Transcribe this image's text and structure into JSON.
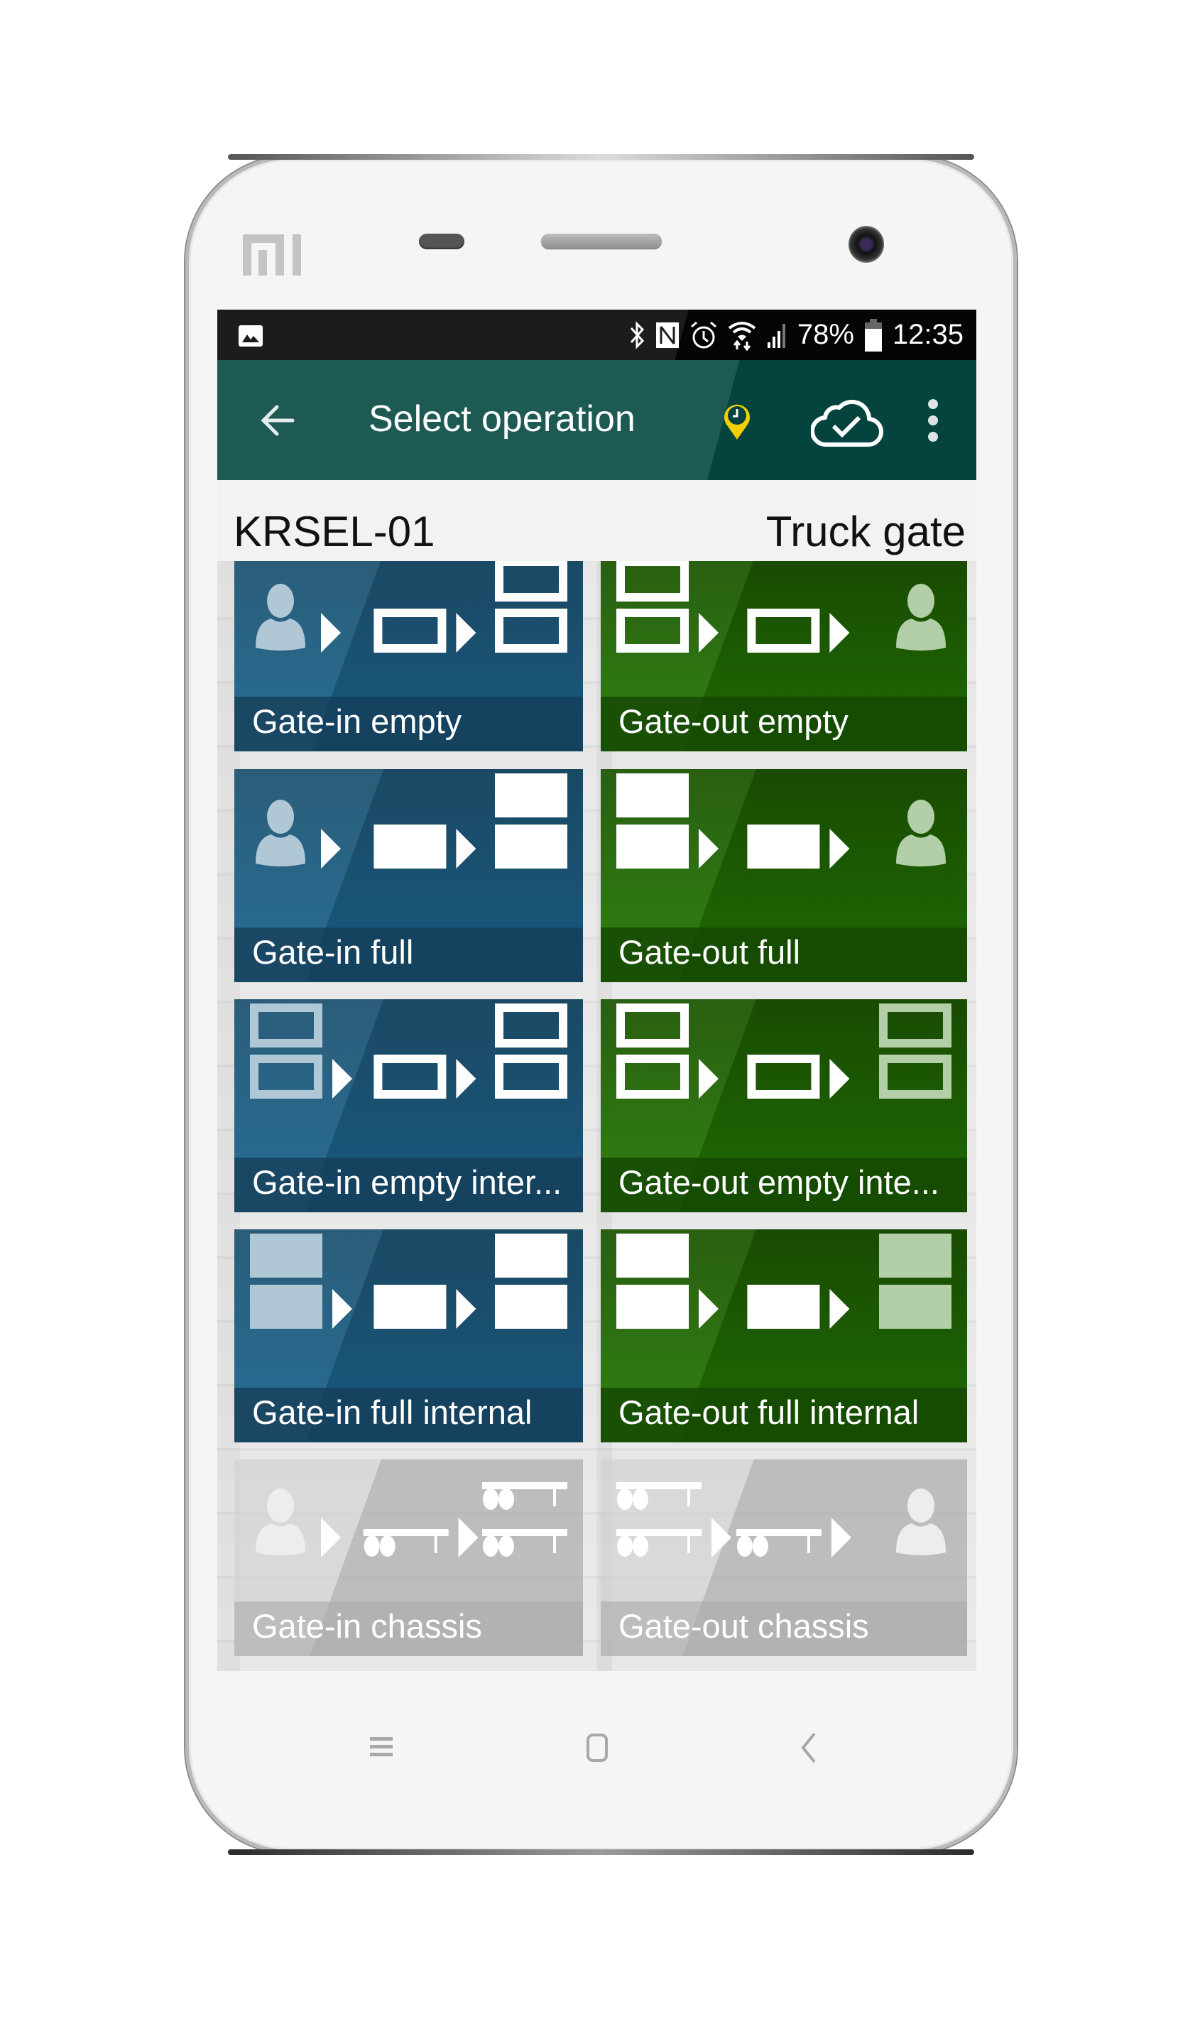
{
  "device": {
    "brand_logo": "mi-logo"
  },
  "status_bar": {
    "left_icons": [
      "image-notification-icon"
    ],
    "right_icons": [
      "bluetooth-icon",
      "nfc-icon",
      "alarm-icon",
      "wifi-icon",
      "cellular-signal-icon"
    ],
    "battery_percent": "78%",
    "battery_level": 0.78,
    "time": "12:35"
  },
  "app_bar": {
    "back_icon": "arrow-left-icon",
    "title": "Select operation",
    "location_icon": "location-clock-pin-icon",
    "sync_icon": "cloud-check-icon",
    "menu_icon": "more-vertical-icon",
    "colors": {
      "primary": "#1e5a54",
      "accent": "#f2d000"
    }
  },
  "header": {
    "terminal_code": "KRSEL-01",
    "gate_type": "Truck gate"
  },
  "operations": [
    {
      "label": "Gate-in empty",
      "color": "blue",
      "enabled": true,
      "icon": {
        "from": "person",
        "via": "box-outline",
        "to": "stack-outline",
        "from_fade": false,
        "to_fade": false
      }
    },
    {
      "label": "Gate-out empty",
      "color": "green",
      "enabled": true,
      "icon": {
        "from": "stack-outline",
        "via": "box-outline",
        "to": "person",
        "from_fade": false,
        "to_fade": false
      }
    },
    {
      "label": "Gate-in full",
      "color": "blue",
      "enabled": true,
      "icon": {
        "from": "person",
        "via": "box-solid",
        "to": "stack-solid",
        "from_fade": false,
        "to_fade": false
      }
    },
    {
      "label": "Gate-out full",
      "color": "green",
      "enabled": true,
      "icon": {
        "from": "stack-solid",
        "via": "box-solid",
        "to": "person",
        "from_fade": false,
        "to_fade": false
      }
    },
    {
      "label": "Gate-in empty inter...",
      "color": "blue",
      "enabled": true,
      "icon": {
        "from": "stack-outline",
        "via": "box-outline",
        "to": "stack-outline",
        "from_fade": true,
        "to_fade": false
      }
    },
    {
      "label": "Gate-out empty inte...",
      "color": "green",
      "enabled": true,
      "icon": {
        "from": "stack-outline",
        "via": "box-outline",
        "to": "stack-outline",
        "from_fade": false,
        "to_fade": true
      }
    },
    {
      "label": "Gate-in full internal",
      "color": "blue",
      "enabled": true,
      "icon": {
        "from": "stack-solid",
        "via": "box-solid",
        "to": "stack-solid",
        "from_fade": true,
        "to_fade": false
      }
    },
    {
      "label": "Gate-out full internal",
      "color": "green",
      "enabled": true,
      "icon": {
        "from": "stack-solid",
        "via": "box-solid",
        "to": "stack-solid",
        "from_fade": false,
        "to_fade": true
      }
    },
    {
      "label": "Gate-in chassis",
      "color": "grey",
      "enabled": false,
      "icon": {
        "from": "person",
        "via": "chassis",
        "to": "stack-chassis",
        "from_fade": false,
        "to_fade": false
      }
    },
    {
      "label": "Gate-out chassis",
      "color": "grey",
      "enabled": false,
      "icon": {
        "from": "stack-chassis",
        "via": "chassis",
        "to": "person",
        "from_fade": false,
        "to_fade": false
      }
    }
  ],
  "nav_bar": {
    "buttons": [
      "menu-lines-icon",
      "home-square-icon",
      "back-chevron-icon"
    ]
  }
}
